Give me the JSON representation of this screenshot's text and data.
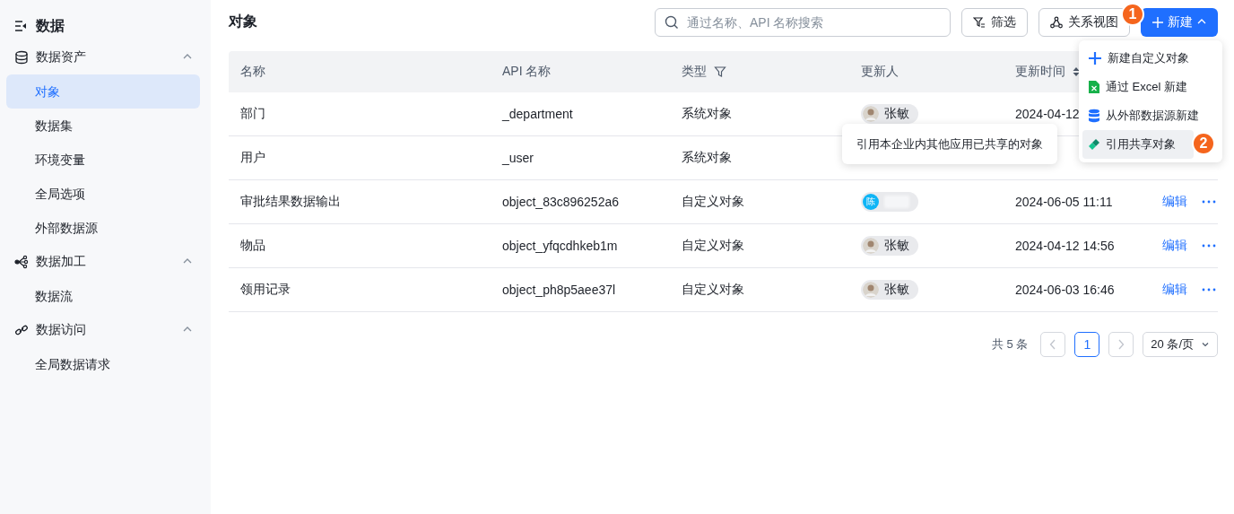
{
  "sidebar": {
    "title": "数据",
    "groups": [
      {
        "label": "数据资产",
        "kind": "database",
        "expanded": true,
        "items": [
          {
            "label": "对象",
            "selected": true
          },
          {
            "label": "数据集",
            "selected": false
          },
          {
            "label": "环境变量",
            "selected": false
          },
          {
            "label": "全局选项",
            "selected": false
          },
          {
            "label": "外部数据源",
            "selected": false
          }
        ]
      },
      {
        "label": "数据加工",
        "kind": "flow",
        "expanded": true,
        "items": [
          {
            "label": "数据流",
            "selected": false
          }
        ]
      },
      {
        "label": "数据访问",
        "kind": "link",
        "expanded": true,
        "items": [
          {
            "label": "全局数据请求",
            "selected": false
          }
        ]
      }
    ]
  },
  "page": {
    "title": "对象"
  },
  "search": {
    "placeholder": "通过名称、API 名称搜索"
  },
  "toolbar": [
    {
      "kind": "filter",
      "label": "筛选"
    },
    {
      "kind": "graph",
      "label": "关系视图"
    }
  ],
  "create_button": {
    "label": "新建",
    "expanded": true
  },
  "table": {
    "columns": [
      {
        "label": "名称",
        "kind": "plain"
      },
      {
        "label": "API 名称",
        "kind": "plain"
      },
      {
        "label": "类型",
        "kind": "filter"
      },
      {
        "label": "更新人",
        "kind": "plain"
      },
      {
        "label": "更新时间",
        "kind": "sort"
      }
    ],
    "rows": [
      {
        "name": "部门",
        "api_name": "_department",
        "type": "系统对象",
        "updater": {
          "kind": "photo",
          "name": "张敏"
        },
        "updated_at": "2024-04-12"
      },
      {
        "name": "用户",
        "api_name": "_user",
        "type": "系统对象"
      },
      {
        "name": "审批结果数据输出",
        "api_name": "object_83c896252a6",
        "type": "自定义对象",
        "updater": {
          "kind": "initial",
          "initial": "陈"
        },
        "updated_at": "2024-06-05 11:11",
        "actions": {
          "edit": "编辑"
        }
      },
      {
        "name": "物品",
        "api_name": "object_yfqcdhkeb1m",
        "type": "自定义对象",
        "updater": {
          "kind": "photo",
          "name": "张敏"
        },
        "updated_at": "2024-04-12 14:56",
        "actions": {
          "edit": "编辑"
        }
      },
      {
        "name": "领用记录",
        "api_name": "object_ph8p5aee37l",
        "type": "自定义对象",
        "updater": {
          "kind": "photo",
          "name": "张敏"
        },
        "updated_at": "2024-06-03 16:46",
        "actions": {
          "edit": "编辑"
        }
      }
    ]
  },
  "pagination": {
    "total": "共 5 条",
    "pages": [
      {
        "label": "1",
        "selected": true
      }
    ],
    "page_size": "20 条/页"
  },
  "dropdown": {
    "items": [
      {
        "kind": "plus",
        "label": "新建自定义对象",
        "selected": false
      },
      {
        "kind": "excel",
        "label": "通过 Excel 新建",
        "selected": false
      },
      {
        "kind": "database",
        "label": "从外部数据源新建",
        "selected": false
      },
      {
        "kind": "share",
        "label": "引用共享对象",
        "selected": true
      }
    ]
  },
  "tooltip": {
    "text": "引用本企业内其他应用已共享的对象"
  },
  "step_badges": [
    "1",
    "2"
  ]
}
